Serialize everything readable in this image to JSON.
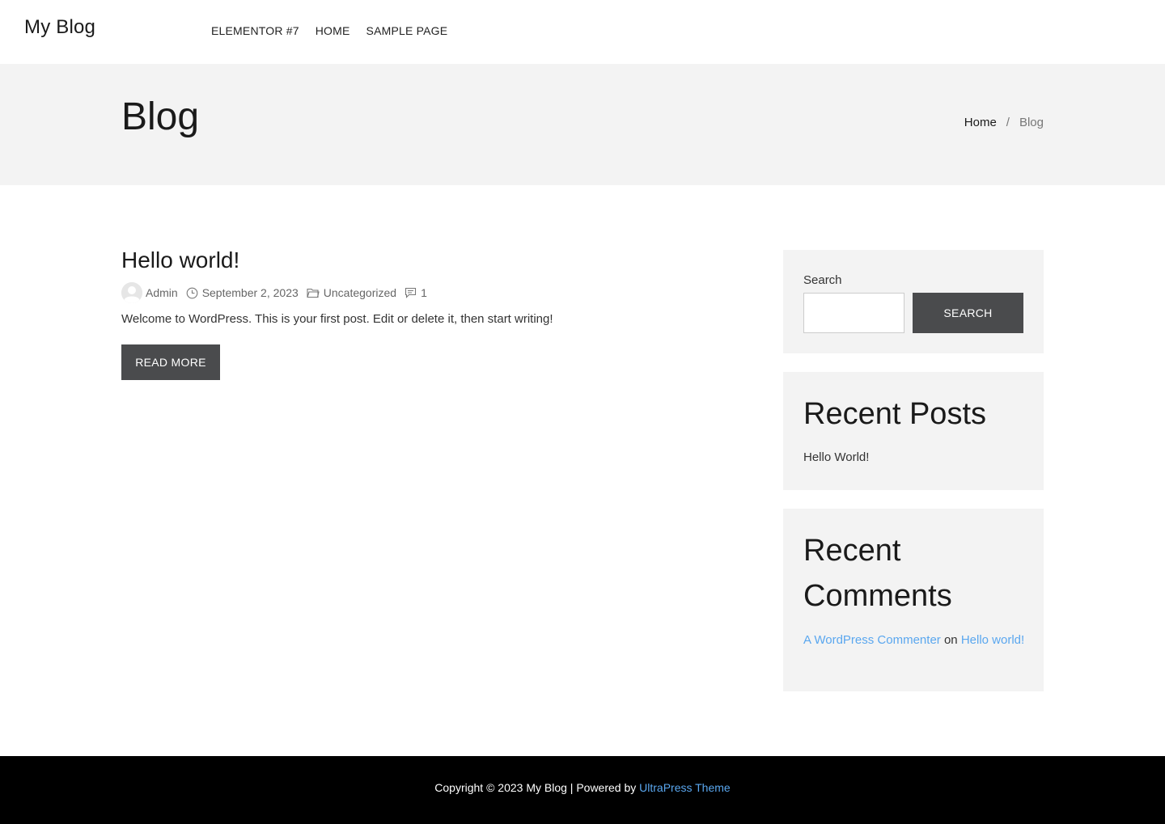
{
  "header": {
    "site_title": "My Blog",
    "nav": [
      {
        "label": "ELEMENTOR #7"
      },
      {
        "label": "HOME"
      },
      {
        "label": "SAMPLE PAGE"
      }
    ]
  },
  "page_header": {
    "title": "Blog",
    "breadcrumb": {
      "home": "Home",
      "separator": "/",
      "current": "Blog"
    }
  },
  "post": {
    "title": "Hello world!",
    "meta": {
      "author": "Admin",
      "date": "September 2, 2023",
      "category": "Uncategorized",
      "comments": "1"
    },
    "excerpt": "Welcome to WordPress. This is your first post. Edit or delete it, then start writing!",
    "read_more": "READ MORE"
  },
  "sidebar": {
    "search": {
      "label": "Search",
      "button": "SEARCH",
      "value": "",
      "placeholder": ""
    },
    "recent_posts": {
      "title": "Recent Posts",
      "items": [
        "Hello World!"
      ]
    },
    "recent_comments": {
      "title": "Recent Comments",
      "author": "A WordPress Commenter",
      "on": "on",
      "post": "Hello world!"
    }
  },
  "footer": {
    "text": "Copyright © 2023 My Blog | Powered by",
    "link": "UltraPress Theme"
  },
  "colors": {
    "accent": "#5aa7ef",
    "button_bg": "#4a4b4d",
    "band_bg": "#f3f3f3",
    "footer_bg": "#000000"
  },
  "icons": [
    "avatar",
    "clock-icon",
    "folder-icon",
    "comment-icon"
  ]
}
